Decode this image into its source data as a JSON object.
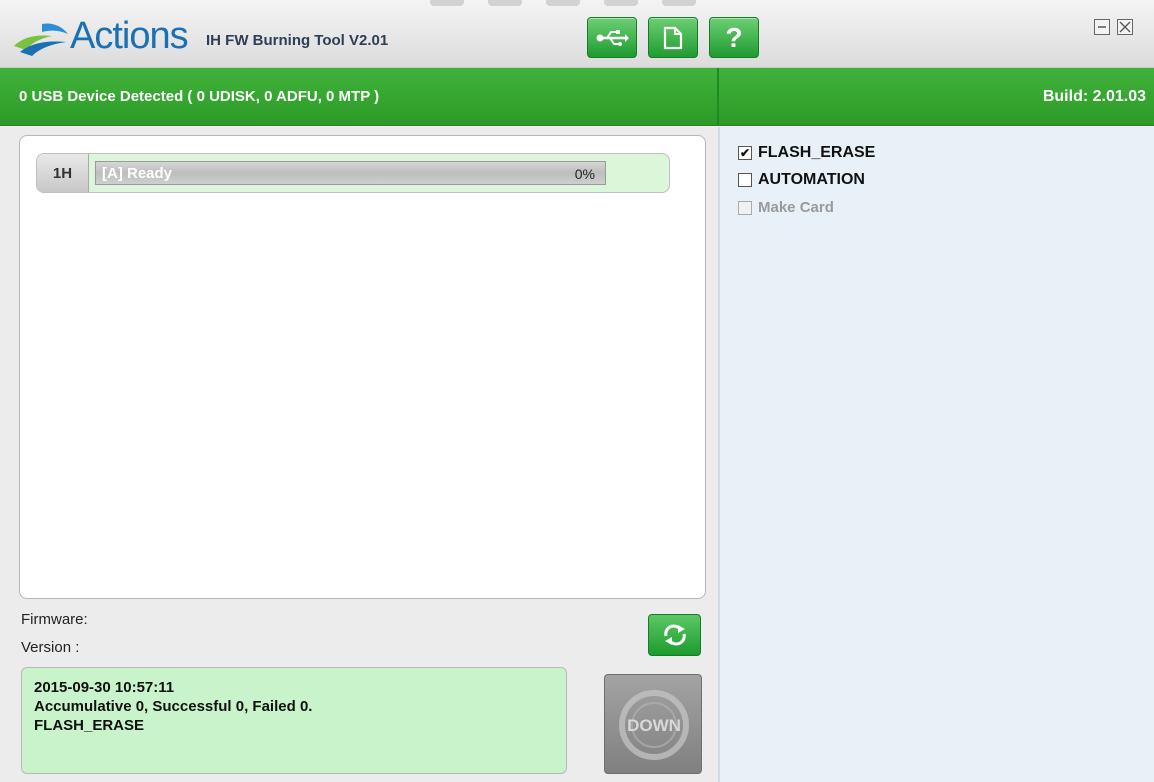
{
  "app": {
    "brand": "Actions",
    "title": "IH FW Burning Tool V2.01"
  },
  "toolbar": {
    "buttons": [
      {
        "name": "usb-icon",
        "label": ""
      },
      {
        "name": "file-icon",
        "label": ""
      },
      {
        "name": "help-icon",
        "label": "?"
      }
    ]
  },
  "status": {
    "devices": "0 USB Device Detected ( 0 UDISK, 0 ADFU, 0 MTP )",
    "build": "Build: 2.01.03"
  },
  "devices": [
    {
      "port": "1H",
      "status": "[A] Ready",
      "progress_text": "0%",
      "progress": 0
    }
  ],
  "firmware": {
    "firmware_label": "Firmware:",
    "version_label": "Version :"
  },
  "log": {
    "line1": "2015-09-30 10:57:11",
    "line2": "Accumulative 0, Successful 0, Failed 0.",
    "line3": "FLASH_ERASE"
  },
  "down_button": {
    "label": "DOWN"
  },
  "options": [
    {
      "label": "FLASH_ERASE",
      "checked": true,
      "enabled": true
    },
    {
      "label": "AUTOMATION",
      "checked": false,
      "enabled": true
    },
    {
      "label": "Make Card",
      "checked": false,
      "enabled": false
    }
  ],
  "colors": {
    "accent_green": "#35a832",
    "log_background": "#c9f4cb",
    "brand_blue": "#1a6fb5"
  }
}
